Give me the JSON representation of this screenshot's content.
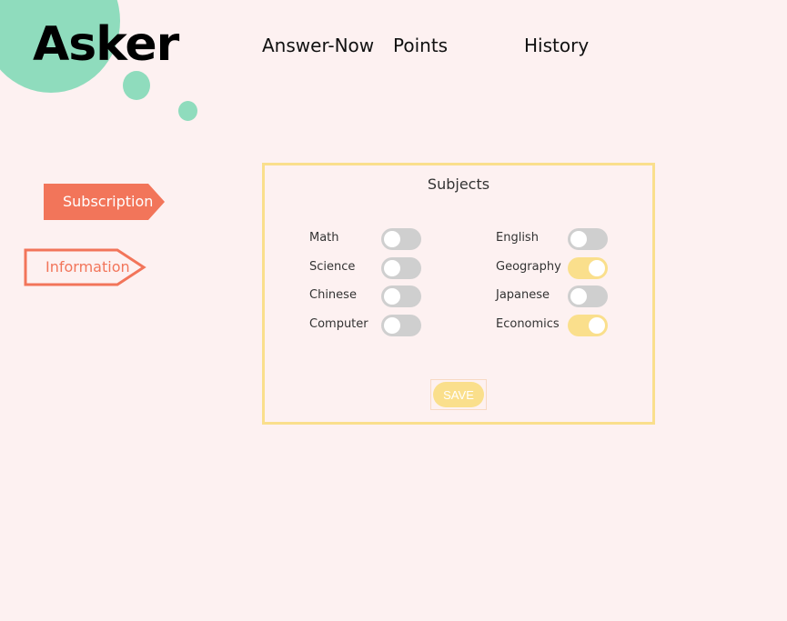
{
  "app": {
    "logo": "Asker"
  },
  "nav": {
    "items": [
      {
        "label": "Answer-Now"
      },
      {
        "label": "Points"
      },
      {
        "label": "History"
      }
    ]
  },
  "sidebar": {
    "items": [
      {
        "label": "Subscription",
        "state": "active"
      },
      {
        "label": "Information",
        "state": "inactive"
      }
    ]
  },
  "subjects_panel": {
    "title": "Subjects",
    "left_column": [
      {
        "label": "Math",
        "enabled": false
      },
      {
        "label": "Science",
        "enabled": false
      },
      {
        "label": "Chinese",
        "enabled": false
      },
      {
        "label": "Computer",
        "enabled": false
      }
    ],
    "right_column": [
      {
        "label": "English",
        "enabled": false
      },
      {
        "label": "Geography",
        "enabled": true
      },
      {
        "label": "Japanese",
        "enabled": false
      },
      {
        "label": "Economics",
        "enabled": true
      }
    ],
    "save_label": "SAVE"
  },
  "colors": {
    "background": "#fdf1f1",
    "blob": "#8fdcbd",
    "accent": "#f2755a",
    "toggle_on": "#fadf8c",
    "toggle_off": "#cfcfcf",
    "panel_border": "#fadf8c"
  }
}
